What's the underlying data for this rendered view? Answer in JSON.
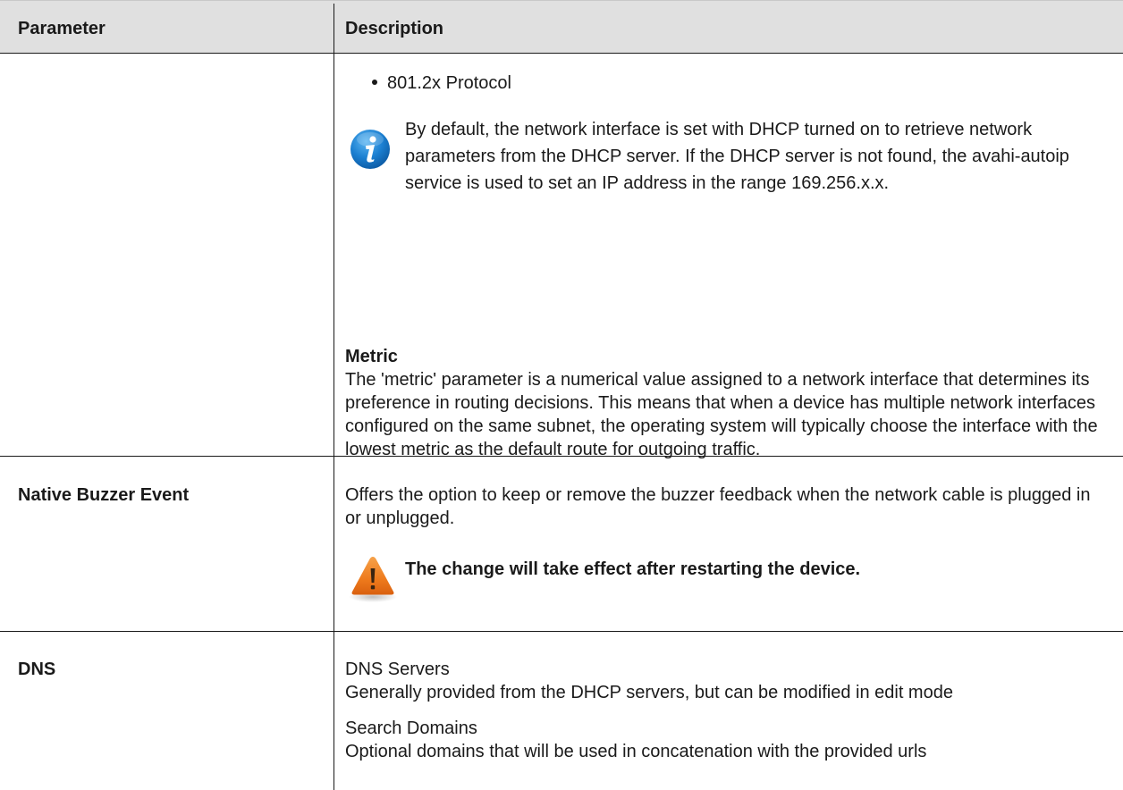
{
  "table": {
    "header": {
      "parameter": "Parameter",
      "description": "Description"
    },
    "rows": [
      {
        "parameter": "",
        "bullet": "801.2x Protocol",
        "note": "By default, the network interface is set with DHCP turned on to retrieve network parameters from the DHCP server. If the DHCP server is not found, the avahi-autoip service is used to set an IP address in the range 169.256.x.x.",
        "note_icon": "info-icon",
        "metric_heading": "Metric",
        "metric_text": "The 'metric' parameter is a numerical value assigned to a network interface that determines its preference in routing decisions. This means that when a device has multiple network interfaces configured on the same subnet, the operating system will typically choose the interface with the lowest metric as the default route for outgoing traffic."
      },
      {
        "parameter": "Native Buzzer Event",
        "description": "Offers the option to keep or remove the buzzer feedback when the network cable is plugged in or unplugged.",
        "warning": "The change will take effect after restarting the device.",
        "warning_icon": "warning-icon"
      },
      {
        "parameter": "DNS",
        "dns_servers_title": "DNS Servers",
        "dns_servers_text": "Generally provided from the DHCP servers, but can be modified in edit mode",
        "search_domains_title": "Search Domains",
        "search_domains_text": "Optional domains that will be used in concatenation with the provided urls"
      }
    ]
  },
  "colors": {
    "header_bg": "#e0e0e0",
    "text": "#1a1a1a",
    "info_blue": "#1b7fd1",
    "warning_orange": "#ee7a1c"
  }
}
